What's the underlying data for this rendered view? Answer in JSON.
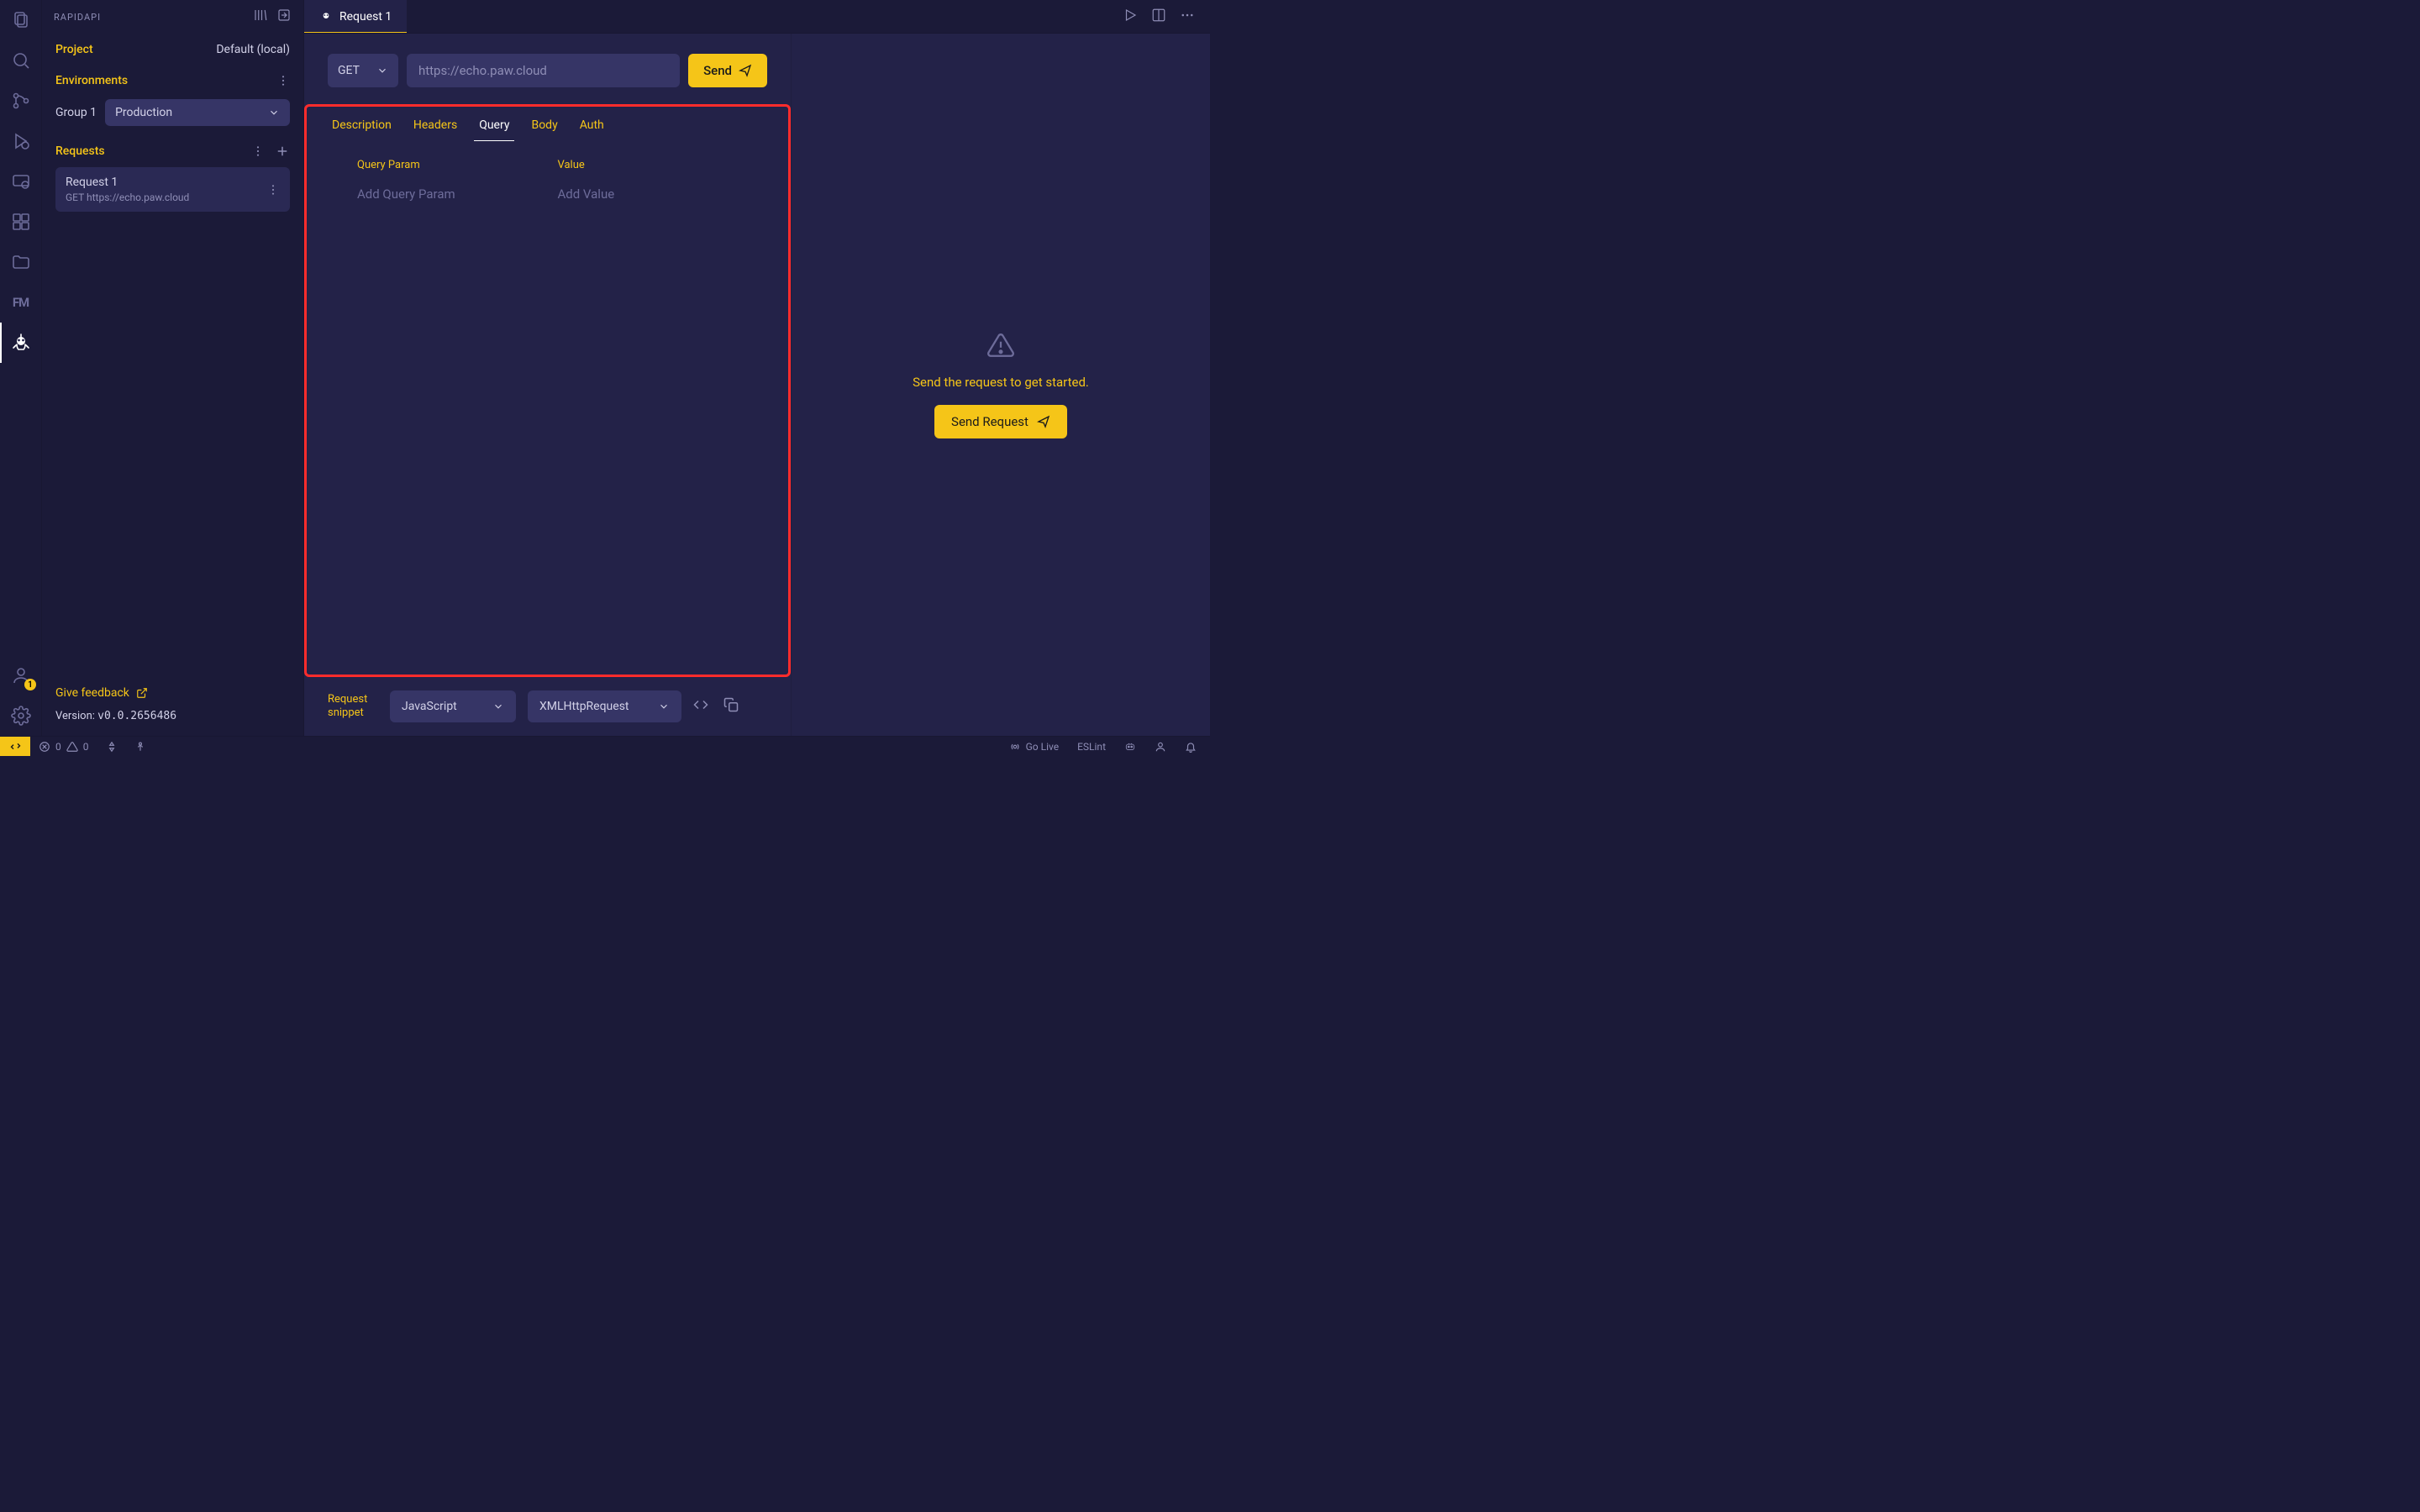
{
  "accent_color": "#f5c518",
  "highlight_border_color": "#ff2c2c",
  "activity": {
    "account_badge": "1"
  },
  "sidebar": {
    "title": "RAPIDAPI",
    "project_label": "Project",
    "project_value": "Default (local)",
    "env_label": "Environments",
    "group_label": "Group 1",
    "env_value": "Production",
    "requests_label": "Requests",
    "request": {
      "name": "Request 1",
      "subtitle": "GET https://echo.paw.cloud"
    },
    "feedback_label": "Give feedback",
    "version_prefix": "Version: ",
    "version_value": "v0.0.2656486"
  },
  "tabstrip": {
    "tab_label": "Request 1"
  },
  "request_bar": {
    "method": "GET",
    "url": "https://echo.paw.cloud",
    "send_label": "Send"
  },
  "inner_tabs": {
    "description": "Description",
    "headers": "Headers",
    "query": "Query",
    "body": "Body",
    "auth": "Auth"
  },
  "query": {
    "col_param": "Query Param",
    "col_value": "Value",
    "ph_param": "Add Query Param",
    "ph_value": "Add Value"
  },
  "snippet": {
    "label_line1": "Request",
    "label_line2": "snippet",
    "language": "JavaScript",
    "client": "XMLHttpRequest"
  },
  "response": {
    "message": "Send the request to get started.",
    "button": "Send Request"
  },
  "status": {
    "errors": "0",
    "warnings": "0",
    "go_live": "Go Live",
    "eslint": "ESLint"
  }
}
